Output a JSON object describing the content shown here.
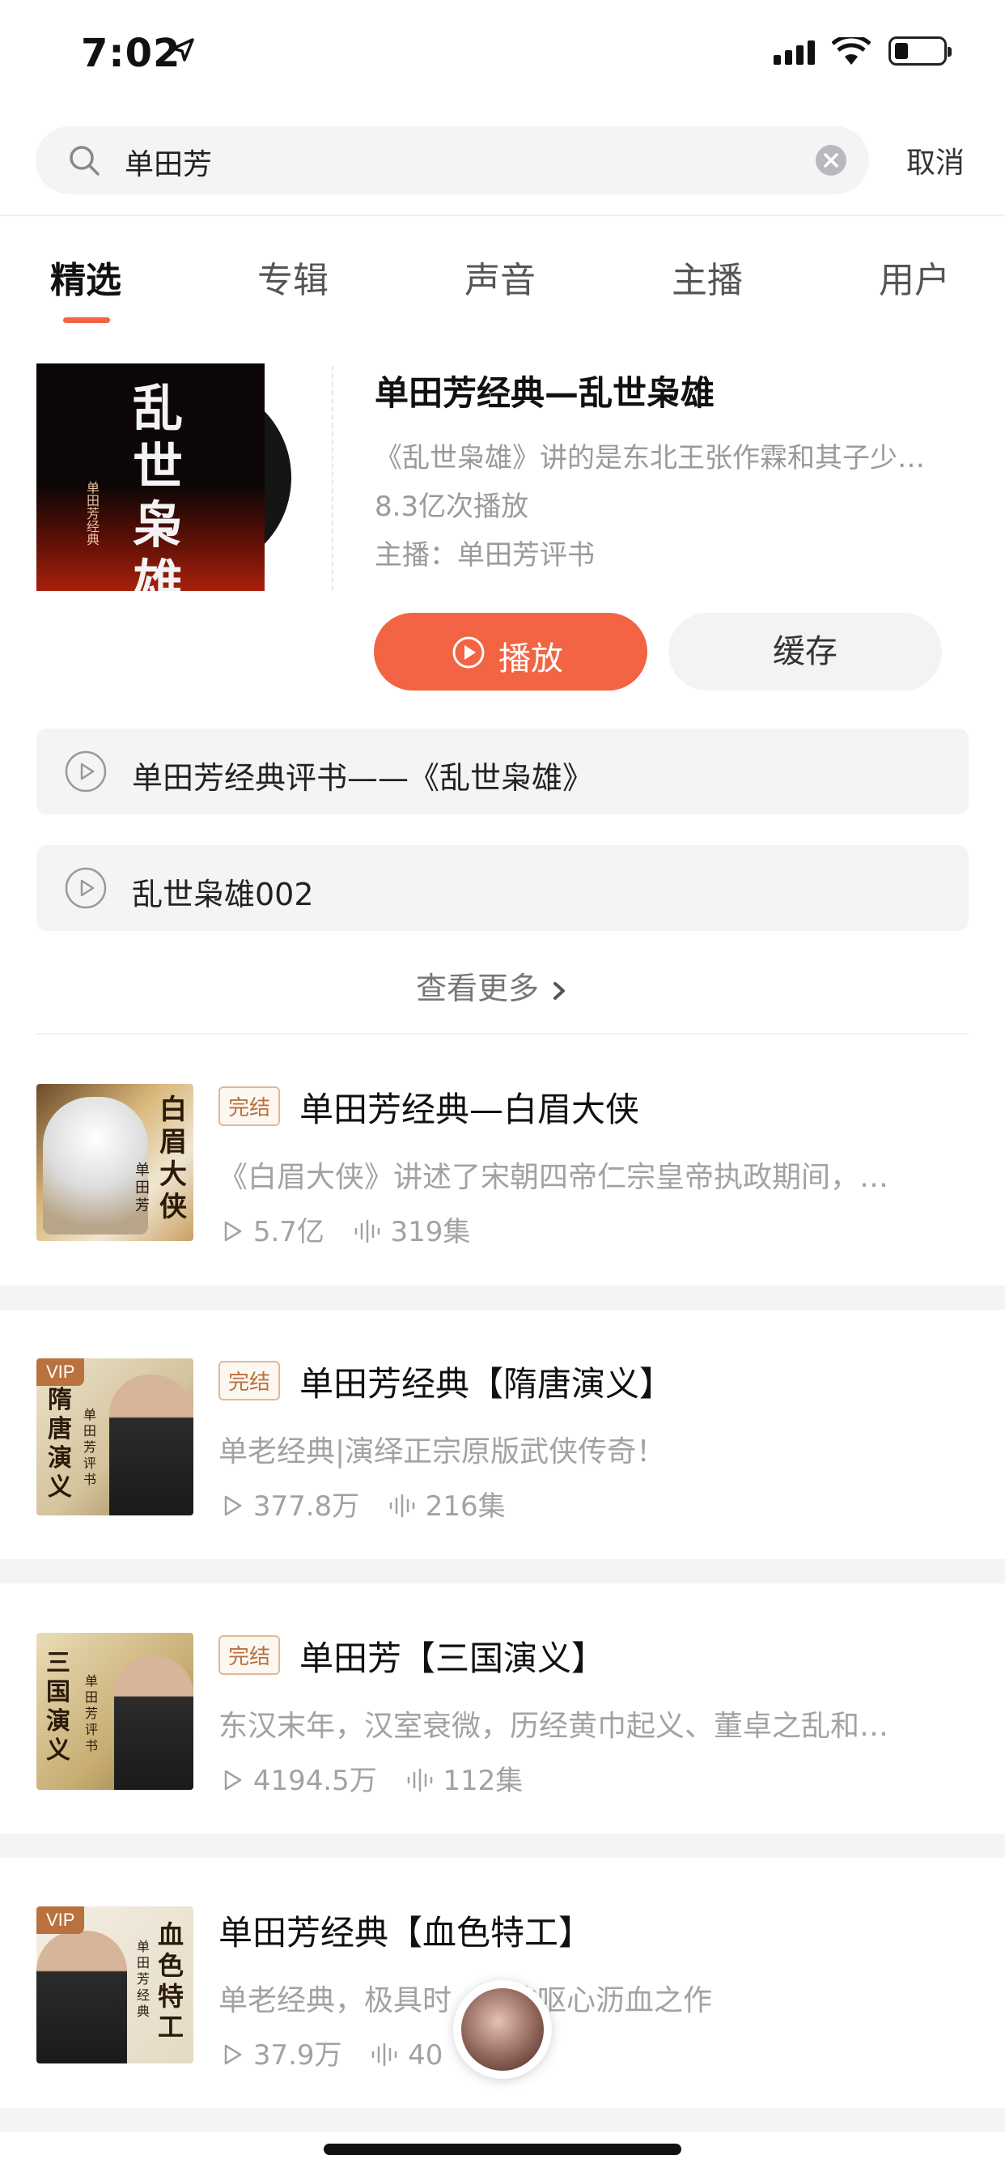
{
  "status_bar": {
    "time": "7:02"
  },
  "search": {
    "query": "单田芳",
    "cancel_label": "取消"
  },
  "tabs": [
    {
      "label": "精选",
      "active": true
    },
    {
      "label": "专辑",
      "active": false
    },
    {
      "label": "声音",
      "active": false
    },
    {
      "label": "主播",
      "active": false
    },
    {
      "label": "用户",
      "active": false
    }
  ],
  "featured": {
    "cover_text": "乱世枭雄",
    "cover_subtext": "单田芳经典",
    "title": "单田芳经典—乱世枭雄",
    "description": "《乱世枭雄》讲的是东北王张作霖和其子少…",
    "plays": "8.3亿次播放",
    "host": "主播：单田芳评书",
    "play_label": "播放",
    "cache_label": "缓存"
  },
  "tracks": [
    {
      "title": "单田芳经典评书——《乱世枭雄》"
    },
    {
      "title": "乱世枭雄002"
    }
  ],
  "see_more_label": "查看更多",
  "albums": [
    {
      "badge": "完结",
      "vip": "",
      "title": "单田芳经典—白眉大侠",
      "description": "《白眉大侠》讲述了宋朝四帝仁宗皇帝执政期间，…",
      "plays": "5.7亿",
      "episodes": "319集",
      "cover_text": "白眉大侠",
      "cover_sub": "单田芳"
    },
    {
      "badge": "完结",
      "vip": "VIP",
      "title": "单田芳经典【隋唐演义】",
      "description": "单老经典|演绎正宗原版武侠传奇！",
      "plays": "377.8万",
      "episodes": "216集",
      "cover_text": "隋唐演义",
      "cover_sub": "单田芳评书"
    },
    {
      "badge": "完结",
      "vip": "",
      "title": "单田芳【三国演义】",
      "description": "东汉末年，汉室衰微，历经黄巾起义、董卓之乱和…",
      "plays": "4194.5万",
      "episodes": "112集",
      "cover_text": "三国演义",
      "cover_sub": "单田芳评书"
    },
    {
      "badge": "",
      "vip": "VIP",
      "title": "单田芳经典【血色特工】",
      "description": "单老经典，极具时",
      "description_tail": "的呕心沥血之作",
      "plays": "37.9万",
      "episodes": "40",
      "cover_text": "血色特工",
      "cover_sub": "单田芳经典"
    }
  ],
  "colors": {
    "accent": "#f26443",
    "badge": "#b9723e"
  }
}
